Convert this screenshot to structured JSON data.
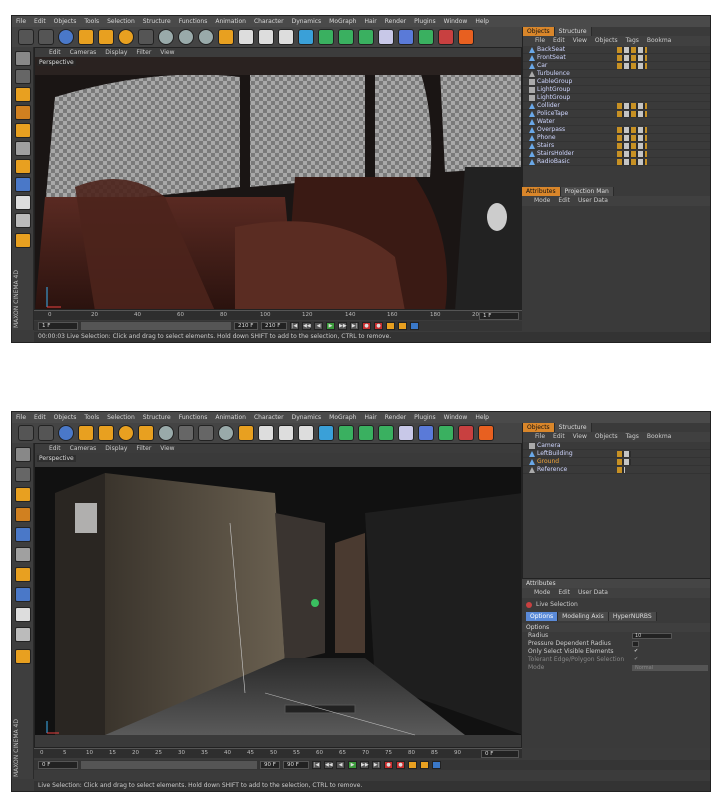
{
  "menu": [
    "File",
    "Edit",
    "Objects",
    "Tools",
    "Selection",
    "Structure",
    "Functions",
    "Animation",
    "Character",
    "Dynamics",
    "MoGraph",
    "Hair",
    "Render",
    "Plugins",
    "Window",
    "Help"
  ],
  "brand": "MAXON CINEMA 4D",
  "colors": {
    "accent": "#d9862a",
    "bg": "#3b3b3b",
    "selected": "#f2a53a"
  },
  "panel1": {
    "viewport_menu": [
      "Edit",
      "Cameras",
      "Display",
      "Filter",
      "View"
    ],
    "viewport_label": "Perspective",
    "tabs": [
      "Objects",
      "Structure"
    ],
    "object_menu": [
      "File",
      "Edit",
      "View",
      "Objects",
      "Tags",
      "Bookma"
    ],
    "objects": [
      "BackSeat",
      "FrontSeat",
      "Car",
      "Turbulence",
      "CableGroup",
      "LightGroup",
      "LightGroup",
      "Collider",
      "PoliceTape",
      "Water",
      "Overpass",
      "Phone",
      "Stairs",
      "StairsHolder",
      "RadioBasic"
    ],
    "attr_tabs": [
      "Attributes",
      "Projection Man"
    ],
    "attr_menu": [
      "Mode",
      "Edit",
      "User Data"
    ],
    "ticks": [
      "0",
      "20",
      "40",
      "60",
      "80",
      "100",
      "120",
      "140",
      "160",
      "180",
      "200"
    ],
    "timeline_end": "1 F",
    "frame_start": "1 F",
    "frame_mid": "210 F",
    "frame_end": "210 F",
    "status": "00:00:03  Live Selection: Click and drag to select elements. Hold down SHIFT to add to the selection, CTRL to remove."
  },
  "panel2": {
    "viewport_menu": [
      "Edit",
      "Cameras",
      "Display",
      "Filter",
      "View"
    ],
    "viewport_label": "Perspective",
    "tabs": [
      "Objects",
      "Structure"
    ],
    "object_menu": [
      "File",
      "Edit",
      "View",
      "Objects",
      "Tags",
      "Bookma"
    ],
    "objects": [
      "Camera",
      "LeftBuilding",
      "Ground",
      "Reference"
    ],
    "selected_object": "Ground",
    "attributes_title": "Attributes",
    "attr_menu": [
      "Mode",
      "Edit",
      "User Data"
    ],
    "tool_name": "Live Selection",
    "tool_tabs": [
      "Options",
      "Modeling Axis",
      "HyperNURBS"
    ],
    "options_header": "Options",
    "options": [
      {
        "label": "Radius",
        "value": "10"
      },
      {
        "label": "Pressure Dependent Radius",
        "value": ""
      },
      {
        "label": "Only Select Visible Elements",
        "value": "✔"
      },
      {
        "label": "Tolerant Edge/Polygon Selection",
        "value": "✔"
      },
      {
        "label": "Mode",
        "value": "Normal"
      }
    ],
    "ticks": [
      "0",
      "5",
      "10",
      "15",
      "20",
      "25",
      "30",
      "35",
      "40",
      "45",
      "50",
      "55",
      "60",
      "65",
      "70",
      "75",
      "80",
      "85",
      "90"
    ],
    "timeline_end": "0 F",
    "frame_start": "0 F",
    "frame_mid": "90 F",
    "frame_end": "90 F",
    "status": "Live Selection: Click and drag to select elements. Hold down SHIFT to add to the selection, CTRL to remove."
  }
}
